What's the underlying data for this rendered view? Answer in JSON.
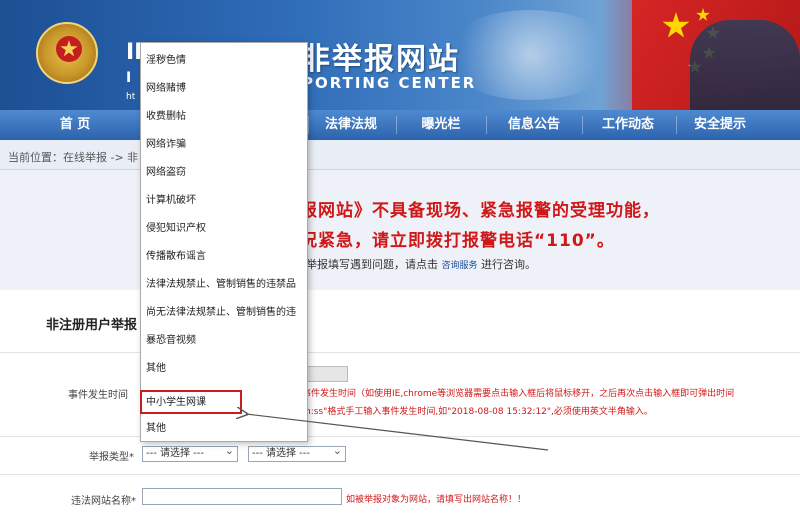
{
  "banner": {
    "prefix": "I",
    "prefix2": "IN",
    "prefix3": "ht",
    "title": "非举报网站",
    "subtitle": "PORTING CENTER",
    "accent": "#d01818"
  },
  "nav": {
    "items": [
      "首 页",
      "法律法规",
      "曝光栏",
      "信息公告",
      "工作动态",
      "安全提示"
    ]
  },
  "breadcrumb": {
    "text": "当前位置：在线举报 -> 非"
  },
  "notice": {
    "line1": "报网站》不具备现场、紧急报警的受理功能，",
    "line2": "况紧急，请立即拨打报警电话“110”。",
    "hint_prefix": "举报填写遇到问题，请点击",
    "hint_link": "咨询服务",
    "hint_suffix": "进行咨询。"
  },
  "form": {
    "heading": "非注册用户举报",
    "event_time_label": "事件发生时间",
    "event_time_note1": "事件发生时间（如使用IE,chrome等浏览器需要点击输入框后将鼠标移开，之后再次点击输入框即可弹出时间",
    "event_time_note2": "m:ss\"格式手工输入事件发生时间,如\"2018-08-08 15:32:12\",必须使用英文半角输入。",
    "report_type_label": "举报类型*",
    "report_type_select1": "--- 请选择 ---",
    "report_type_select2": "--- 请选择 ---",
    "site_name_label": "违法网站名称*",
    "site_name_hint": "如被举报对象为网站，请填写出网站名称！！"
  },
  "dropdown": {
    "items": [
      "淫秽色情",
      "网络赌博",
      "收费删帖",
      "网络诈骗",
      "网络盗窃",
      "计算机破坏",
      "侵犯知识产权",
      "传播散布谣言",
      "法律法规禁止、管制销售的违禁品",
      "尚无法律法规禁止、管制销售的违",
      "暴恐音视频",
      "其他",
      "中小学生网课",
      "其他"
    ],
    "highlighted": "中小学生网课",
    "highlight_color": "#c81e1e"
  }
}
